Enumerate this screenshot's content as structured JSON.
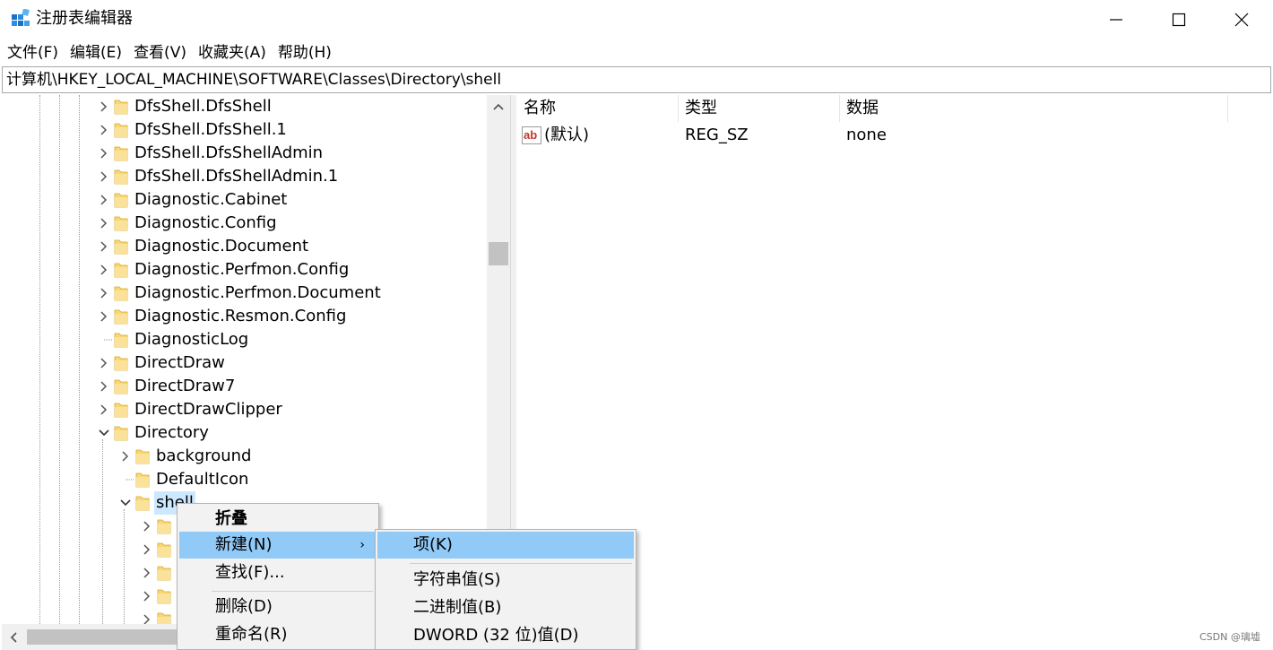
{
  "window": {
    "title": "注册表编辑器",
    "icon": "registry-editor-icon",
    "controls": [
      "minimize-icon",
      "maximize-icon",
      "close-icon"
    ]
  },
  "menubar": {
    "items": [
      "文件(F)",
      "编辑(E)",
      "查看(V)",
      "收藏夹(A)",
      "帮助(H)"
    ]
  },
  "address": {
    "path": "计算机\\HKEY_LOCAL_MACHINE\\SOFTWARE\\Classes\\Directory\\shell"
  },
  "tree": {
    "items": [
      {
        "label": "DfsShell.DfsShell",
        "expander": "collapsed"
      },
      {
        "label": "DfsShell.DfsShell.1",
        "expander": "collapsed"
      },
      {
        "label": "DfsShell.DfsShellAdmin",
        "expander": "collapsed"
      },
      {
        "label": "DfsShell.DfsShellAdmin.1",
        "expander": "collapsed"
      },
      {
        "label": "Diagnostic.Cabinet",
        "expander": "collapsed"
      },
      {
        "label": "Diagnostic.Config",
        "expander": "collapsed"
      },
      {
        "label": "Diagnostic.Document",
        "expander": "collapsed"
      },
      {
        "label": "Diagnostic.Perfmon.Config",
        "expander": "collapsed"
      },
      {
        "label": "Diagnostic.Perfmon.Document",
        "expander": "collapsed"
      },
      {
        "label": "Diagnostic.Resmon.Config",
        "expander": "collapsed"
      },
      {
        "label": "DiagnosticLog",
        "expander": "none"
      },
      {
        "label": "DirectDraw",
        "expander": "collapsed"
      },
      {
        "label": "DirectDraw7",
        "expander": "collapsed"
      },
      {
        "label": "DirectDrawClipper",
        "expander": "collapsed"
      },
      {
        "label": "Directory",
        "expander": "expanded"
      },
      {
        "label": "background",
        "expander": "collapsed"
      },
      {
        "label": "DefaultIcon",
        "expander": "none"
      },
      {
        "label": "shell",
        "expander": "expanded",
        "selected": true
      },
      {
        "label": "",
        "expander": "collapsed"
      },
      {
        "label": "",
        "expander": "collapsed"
      },
      {
        "label": "",
        "expander": "collapsed"
      },
      {
        "label": "",
        "expander": "collapsed"
      },
      {
        "label": "",
        "expander": "collapsed"
      }
    ]
  },
  "list": {
    "columns": [
      "名称",
      "类型",
      "数据"
    ],
    "rows": [
      {
        "name": "(默认)",
        "type": "REG_SZ",
        "data": "none",
        "icon": "string-value-icon"
      }
    ]
  },
  "context_menu": {
    "items": [
      "折叠",
      "新建(N)",
      "查找(F)...",
      "删除(D)",
      "重命名(R)"
    ],
    "highlighted": "新建(N)"
  },
  "submenu": {
    "items": [
      "项(K)",
      "字符串值(S)",
      "二进制值(B)",
      "DWORD (32 位)值(D)"
    ],
    "highlighted": "项(K)"
  },
  "watermark": "CSDN @璃墟",
  "colors": {
    "selection": "#cce8ff",
    "menu_highlight": "#91c9f7",
    "folder": "#f8d775"
  }
}
